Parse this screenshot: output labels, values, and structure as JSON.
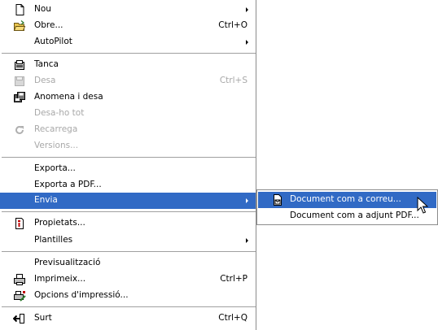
{
  "menu": {
    "items": [
      {
        "label": "Nou",
        "shortcut": "",
        "submenu": true,
        "icon": "new-document-icon",
        "disabled": false
      },
      {
        "label": "Obre...",
        "shortcut": "Ctrl+O",
        "submenu": false,
        "icon": "open-folder-icon",
        "disabled": false
      },
      {
        "label": "AutoPilot",
        "shortcut": "",
        "submenu": true,
        "icon": "",
        "disabled": false
      },
      {
        "label": "Tanca",
        "shortcut": "",
        "submenu": false,
        "icon": "close-document-icon",
        "disabled": false
      },
      {
        "label": "Desa",
        "shortcut": "Ctrl+S",
        "submenu": false,
        "icon": "save-icon",
        "disabled": true
      },
      {
        "label": "Anomena i desa",
        "shortcut": "",
        "submenu": false,
        "icon": "save-as-icon",
        "disabled": false
      },
      {
        "label": "Desa-ho tot",
        "shortcut": "",
        "submenu": false,
        "icon": "",
        "disabled": true
      },
      {
        "label": "Recarrega",
        "shortcut": "",
        "submenu": false,
        "icon": "reload-icon",
        "disabled": true
      },
      {
        "label": "Versions...",
        "shortcut": "",
        "submenu": false,
        "icon": "",
        "disabled": true
      },
      {
        "label": "Exporta...",
        "shortcut": "",
        "submenu": false,
        "icon": "",
        "disabled": false
      },
      {
        "label": "Exporta a PDF...",
        "shortcut": "",
        "submenu": false,
        "icon": "",
        "disabled": false
      },
      {
        "label": "Envia",
        "shortcut": "",
        "submenu": true,
        "icon": "",
        "disabled": false,
        "highlighted": true
      },
      {
        "label": "Propietats...",
        "shortcut": "",
        "submenu": false,
        "icon": "properties-icon",
        "disabled": false
      },
      {
        "label": "Plantilles",
        "shortcut": "",
        "submenu": true,
        "icon": "",
        "disabled": false
      },
      {
        "label": "Previsualització",
        "shortcut": "",
        "submenu": false,
        "icon": "",
        "disabled": false
      },
      {
        "label": "Imprimeix...",
        "shortcut": "Ctrl+P",
        "submenu": false,
        "icon": "printer-icon",
        "disabled": false
      },
      {
        "label": "Opcions d'impressió...",
        "shortcut": "",
        "submenu": false,
        "icon": "printer-settings-icon",
        "disabled": false
      },
      {
        "label": "Surt",
        "shortcut": "Ctrl+Q",
        "submenu": false,
        "icon": "exit-icon",
        "disabled": false
      }
    ]
  },
  "submenu": {
    "items": [
      {
        "label": "Document com a correu...",
        "icon": "mail-document-icon",
        "highlighted": true
      },
      {
        "label": "Document com a adjunt PDF...",
        "icon": "",
        "highlighted": false
      }
    ]
  },
  "colors": {
    "highlight": "#316ac5",
    "disabled_text": "#a8a8a8"
  }
}
